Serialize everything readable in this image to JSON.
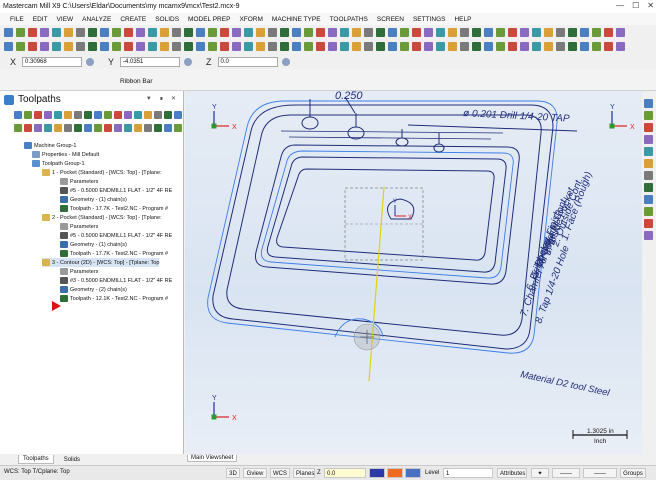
{
  "window": {
    "title": "Mastercam Mill X9  C:\\Users\\Eldar\\Documents\\my mcamx9\\mcx\\Test2.mcx-9"
  },
  "menu": [
    "FILE",
    "EDIT",
    "VIEW",
    "ANALYZE",
    "CREATE",
    "SOLIDS",
    "MODEL PREP",
    "XFORM",
    "MACHINE TYPE",
    "TOOLPATHS",
    "SCREEN",
    "SETTINGS",
    "HELP"
  ],
  "coords": {
    "x_label": "X",
    "x_value": "0.30968",
    "y_label": "Y",
    "y_value": "-4.0351",
    "z_label": "Z",
    "z_value": "0.0"
  },
  "ribbon": {
    "label": "Ribbon Bar"
  },
  "panel": {
    "title": "Toolpaths",
    "tree": [
      {
        "text": "Machine Group-1",
        "level": 1,
        "icon": "machine-group-icon",
        "color": "#4a7fc1"
      },
      {
        "text": "Properties - Mill Default",
        "level": 2,
        "icon": "properties-icon",
        "color": "#7a9cc6"
      },
      {
        "text": "Toolpath Group-1",
        "level": 2,
        "icon": "toolpath-group-icon",
        "color": "#5a8fd0"
      },
      {
        "text": "1 - Pocket (Standard) - [WCS: Top] - [Tplane:",
        "level": 3,
        "icon": "operation-folder-icon",
        "color": "#d9b54a"
      },
      {
        "text": "Parameters",
        "level": 4,
        "icon": "parameters-icon",
        "color": "#9a9a9a"
      },
      {
        "text": "#5 - 0.5000 ENDMILL1 FLAT - 1/2\" 4F RE",
        "level": 4,
        "icon": "tool-icon",
        "color": "#555555"
      },
      {
        "text": "Geometry - (1) chain(s)",
        "level": 4,
        "icon": "geometry-icon",
        "color": "#3c6ea8"
      },
      {
        "text": "Toolpath - 17.7K - Test2.NC - Program #",
        "level": 4,
        "icon": "toolpath-icon",
        "color": "#2f6e3a"
      },
      {
        "text": "2 - Pocket (Standard) - [WCS: Top] - [Tplane:",
        "level": 3,
        "icon": "operation-folder-icon",
        "color": "#d9b54a"
      },
      {
        "text": "Parameters",
        "level": 4,
        "icon": "parameters-icon",
        "color": "#9a9a9a"
      },
      {
        "text": "#5 - 0.5000 ENDMILL1 FLAT - 1/2\" 4F RE",
        "level": 4,
        "icon": "tool-icon",
        "color": "#555555"
      },
      {
        "text": "Geometry - (1) chain(s)",
        "level": 4,
        "icon": "geometry-icon",
        "color": "#3c6ea8"
      },
      {
        "text": "Toolpath - 17.7K - Test2.NC - Program #",
        "level": 4,
        "icon": "toolpath-icon",
        "color": "#2f6e3a"
      },
      {
        "text": "3 - Contour (2D) - [WCS: Top] - [Tplane: Top",
        "level": 3,
        "icon": "operation-folder-icon",
        "color": "#d9b54a",
        "selected": true
      },
      {
        "text": "Parameters",
        "level": 4,
        "icon": "parameters-icon",
        "color": "#9a9a9a"
      },
      {
        "text": "#3 - 0.5000 ENDMILL1 FLAT - 1/2\" 4F RE",
        "level": 4,
        "icon": "tool-icon",
        "color": "#555555"
      },
      {
        "text": "Geometry - (2) chain(s)",
        "level": 4,
        "icon": "geometry-icon",
        "color": "#3c6ea8"
      },
      {
        "text": "Toolpath - 12.1K - Test2.NC - Program #",
        "level": 4,
        "icon": "toolpath-icon",
        "color": "#2f6e3a"
      }
    ],
    "tabs": [
      "Toolpaths",
      "Solids"
    ]
  },
  "viewport": {
    "tab": "Main Viewsheet",
    "dim_text": "0.250",
    "drill_note": "ø 0.201 Drill 1/4-20 TAP",
    "notes": [
      "1. Face (Rough)",
      "2. Outside Cont.",
      "3. Inside Pocket",
      "4. Outside Cont.",
      "5. Pocket Finish",
      "6. Drill holes",
      "7. Chamfer All edge",
      "8. Tap 1/4-20 Hole"
    ],
    "material": "Material D2 tool Steel",
    "scale": {
      "value": "1.3025 in",
      "unit": "Inch"
    },
    "axis_labels": {
      "x": "X",
      "y": "Y",
      "z": "Z"
    }
  },
  "status": {
    "wcs": "WCS: Top  T/Cplane: Top",
    "btn_3d": "3D",
    "gview": "Gview",
    "wcs_btn": "WCS",
    "planes": "Planes",
    "z_label": "Z",
    "z_value": "0.0",
    "level_label": "Level",
    "level_value": "1",
    "attributes": "Attributes",
    "groups": "Groups"
  },
  "colors": {
    "geometry": "#1f2d7a",
    "toolpath": "#3c7ee8",
    "selection_line": "#e2d400",
    "stock_dash": "#888888"
  }
}
